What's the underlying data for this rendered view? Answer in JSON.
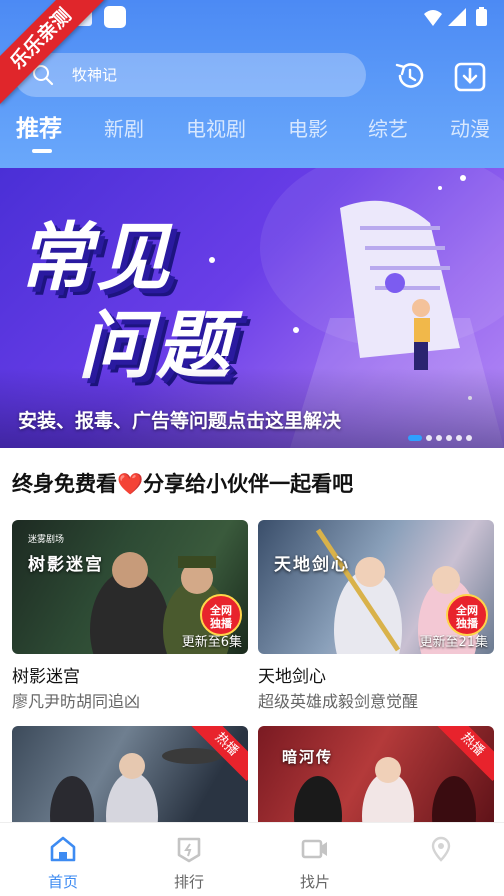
{
  "ribbon": {
    "label": "乐乐亲测"
  },
  "search": {
    "placeholder": "牧神记"
  },
  "tabs": [
    {
      "label": "推荐",
      "active": true
    },
    {
      "label": "新剧"
    },
    {
      "label": "电视剧"
    },
    {
      "label": "电影"
    },
    {
      "label": "综艺"
    },
    {
      "label": "动漫"
    }
  ],
  "banner": {
    "title_line1": "常见",
    "title_line2": "问题",
    "caption": "安装、报毒、广告等问题点击这里解决",
    "total_slides": 6,
    "active_slide": 1
  },
  "section": {
    "title": "终身免费看❤️分享给小伙伴一起看吧"
  },
  "cards": [
    {
      "poster_text": "树影迷宫",
      "logo_text": "迷雾剧场",
      "badge": "全网\n独播",
      "update": "更新至6集",
      "title": "树影迷宫",
      "subtitle": "廖凡尹昉胡同追凶"
    },
    {
      "poster_text": "天地剑心",
      "badge": "全网\n独播",
      "update": "更新至21集",
      "title": "天地剑心",
      "subtitle": "超级英雄成毅剑意觉醒"
    },
    {
      "hot": "热播"
    },
    {
      "poster_text": "暗河传",
      "hot": "热播"
    }
  ],
  "bottom_nav": [
    {
      "label": "首页",
      "icon": "home-icon",
      "active": true
    },
    {
      "label": "排行",
      "icon": "ranking-icon"
    },
    {
      "label": "找片",
      "icon": "video-camera-icon"
    },
    {
      "label": "",
      "icon": "location-pin-icon"
    }
  ],
  "colors": {
    "accent": "#3d8bf2",
    "header": "#5c9bf8",
    "badge": "#e8232c"
  }
}
